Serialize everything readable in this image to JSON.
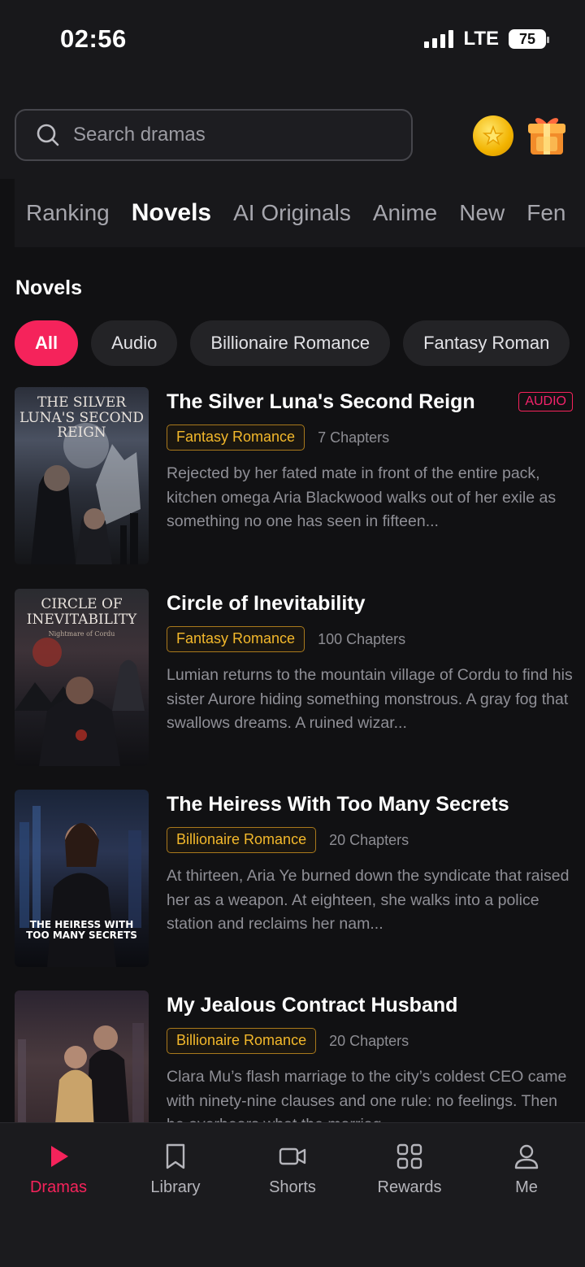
{
  "status": {
    "time": "02:56",
    "network": "LTE",
    "battery": "75"
  },
  "search": {
    "placeholder": "Search dramas"
  },
  "tabs": [
    "Ranking",
    "Novels",
    "AI Originals",
    "Anime",
    "New",
    "Fen"
  ],
  "active_tab": "Novels",
  "section_title": "Novels",
  "chips": [
    "All",
    "Audio",
    "Billionaire Romance",
    "Fantasy Roman"
  ],
  "books": [
    {
      "title": "The Silver Luna's Second Reign",
      "badge": "AUDIO",
      "genre": "Fantasy Romance",
      "chapters": "7 Chapters",
      "description": "Rejected by her fated mate in front of the entire pack, kitchen omega Aria Blackwood walks out of her exile as something no one has seen in fifteen...",
      "cover_text": "THE SILVER LUNA'S SECOND REIGN"
    },
    {
      "title": "Circle of Inevitability",
      "genre": "Fantasy Romance",
      "chapters": "100 Chapters",
      "description": "Lumian returns to the mountain village of Cordu to find his sister Aurore hiding something monstrous. A gray fog that swallows dreams. A ruined wizar...",
      "cover_text": "CIRCLE OF INEVITABILITY",
      "cover_subtext": "Nightmare of Cordu"
    },
    {
      "title": "The Heiress With Too Many Secrets",
      "genre": "Billionaire Romance",
      "chapters": "20 Chapters",
      "description": "At thirteen, Aria Ye burned down the syndicate that raised her as a weapon. At eighteen, she walks into a police station and reclaims her nam...",
      "cover_text": "THE HEIRESS WITH TOO MANY SECRETS"
    },
    {
      "title": "My Jealous Contract Husband",
      "genre": "Billionaire Romance",
      "chapters": "20 Chapters",
      "description": "Clara Mu’s flash marriage to the city’s coldest CEO came with ninety-nine clauses and one rule: no feelings. Then he overhears what the marriag..."
    }
  ],
  "nav": [
    "Dramas",
    "Library",
    "Shorts",
    "Rewards",
    "Me"
  ],
  "active_nav": "Dramas",
  "colors": {
    "accent": "#f5235b",
    "genre": "#f3b82b",
    "background": "#111113"
  }
}
